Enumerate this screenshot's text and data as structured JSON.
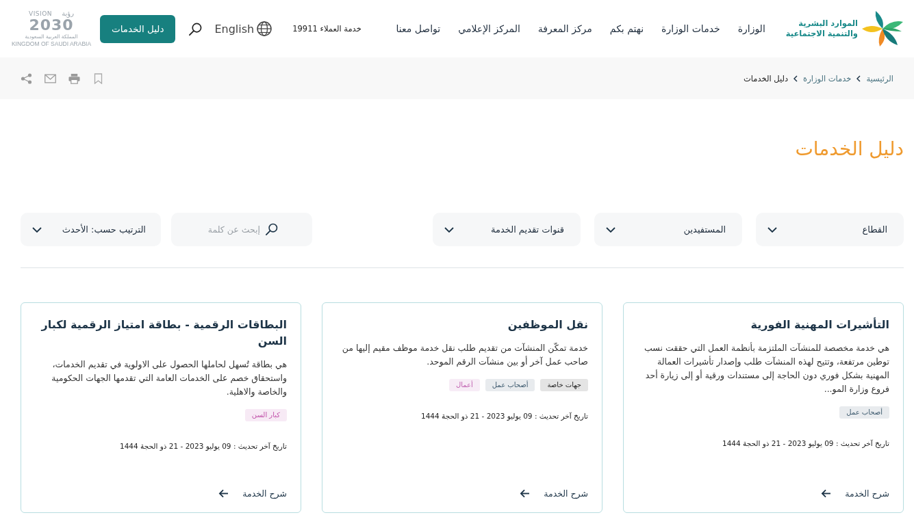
{
  "header": {
    "logo": {
      "lines": [
        "الموارد البشرية",
        "والتنمية الاجتماعية"
      ]
    },
    "nav": [
      "الوزارة",
      "خدمات الوزارة",
      "نهتم بكم",
      "مركز المعرفة",
      "المركز الإعلامي",
      "تواصل معنا"
    ],
    "customer_service": "خدمة العملاء 19911",
    "language": "English",
    "guide_button": "دليل الخدمات",
    "vision_logo": {
      "word_arabic": "رؤية",
      "word_latin": "VISION",
      "year": "2030",
      "country_arabic": "المملكة العربية السعودية",
      "country_latin": "KINGDOM OF SAUDI ARABIA"
    }
  },
  "breadcrumb": [
    {
      "label": "الرئيسية",
      "current": false
    },
    {
      "label": "خدمات الوزارة",
      "current": false
    },
    {
      "label": "دليل الخدمات",
      "current": true
    }
  ],
  "page_title": "دليل الخدمات",
  "filters": [
    {
      "label": "القطاع"
    },
    {
      "label": "المستفيدين"
    },
    {
      "label": "قنوات تقديم الخدمة"
    }
  ],
  "search": {
    "placeholder": "إبحث عن كلمة"
  },
  "sort": {
    "label": "الترتيب حسب: الأحدث"
  },
  "cards": [
    {
      "title": "التأشيرات المهنية الفورية",
      "description": "هي خدمة مخصصة للمنشآت الملتزمة بأنظمة العمل التي حققت نسب توطين مرتفعة، وتتيح لهذه المنشآت طلب وإصدار تأشيرات العمالة المهنية بشكل فوري دون الحاجة إلى مستندات ورقية أو إلى زيارة أحد فروع وزارة المو...",
      "tags": [
        {
          "label": "أصحاب عمل",
          "color": "#3d5a6e"
        }
      ],
      "updated": "تاريخ آخر تحديث : 09 يوليو 2023 - 21 ذو الحجة 1444",
      "link": "شرح الخدمة"
    },
    {
      "title": "نقل الموظفين",
      "description": "خدمة تمكّن المنشآت من تقديم طلب نقل خدمة موظف مقيم إليها من صاحب عمل آخر أو بين منشآت الرقم الموحد.",
      "tags": [
        {
          "label": "جهات خاصة",
          "color": "#222222"
        },
        {
          "label": "أصحاب عمل",
          "color": "#3d5a6e"
        },
        {
          "label": "أعمال",
          "color": "#c060b0"
        }
      ],
      "updated": "تاريخ آخر تحديث : 09 يوليو 2023 - 21 ذو الحجة 1444",
      "link": "شرح الخدمة"
    },
    {
      "title": "البطاقات الرقمية - بطاقة امتياز الرقمية لكبار السن",
      "description": "هي بطاقة تُسهل لحاملها الحصول على الاولوية في تقديم الخدمات، واستحقاق خصم على الخدمات العامة التي تقدمها الجهات الحكومية والخاصة والاهلية.",
      "tags": [
        {
          "label": "كبار السن",
          "color": "#c04fa8"
        }
      ],
      "updated": "تاريخ آخر تحديث : 09 يوليو 2023 - 21 ذو الحجة 1444",
      "link": "شرح الخدمة"
    }
  ]
}
